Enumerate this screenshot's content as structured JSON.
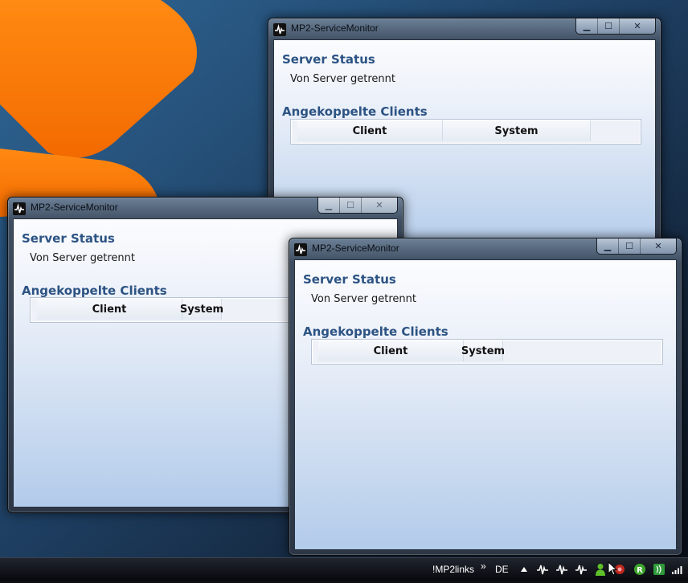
{
  "windows": [
    {
      "title": "MP2-ServiceMonitor",
      "server_status_heading": "Server Status",
      "server_status_text": "Von Server getrennt",
      "clients_heading": "Angekoppelte Clients",
      "columns": [
        "Client",
        "System"
      ]
    },
    {
      "title": "MP2-ServiceMonitor",
      "server_status_heading": "Server Status",
      "server_status_text": "Von Server getrennt",
      "clients_heading": "Angekoppelte Clients",
      "columns": [
        "Client",
        "System"
      ]
    },
    {
      "title": "MP2-ServiceMonitor",
      "server_status_heading": "Server Status",
      "server_status_text": "Von Server getrennt",
      "clients_heading": "Angekoppelte Clients",
      "columns": [
        "Client",
        "System"
      ]
    }
  ],
  "caption_buttons": {
    "minimize": "minimize-icon",
    "maximize": "maximize-icon",
    "close": "close-icon"
  },
  "taskbar": {
    "toolbar_label": "!MP2links",
    "overflow_chevron": "»",
    "language": "DE",
    "tray_icons": [
      "show-hidden-icons-arrow",
      "servicemonitor-icon",
      "servicemonitor-icon",
      "servicemonitor-icon",
      "user-icon",
      "security-icon",
      "green-r-icon",
      "network-icon",
      "signal-icon"
    ]
  },
  "colors": {
    "heading": "#2c5383",
    "desktop_orange": "#ff7a00",
    "desktop_blue": "#2a5780"
  }
}
